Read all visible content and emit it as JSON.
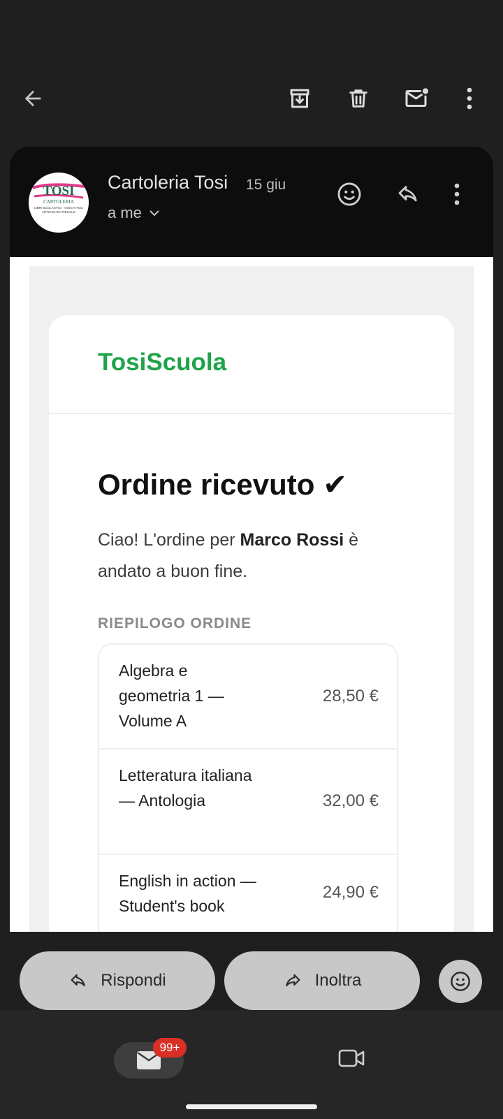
{
  "toolbar": {
    "back_icon": "arrow-back-icon",
    "archive_icon": "archive-icon",
    "delete_icon": "trash-icon",
    "mark_unread_icon": "mark-unread-icon",
    "more_icon": "more-vert-icon"
  },
  "message": {
    "sender_name": "Cartoleria Tosi",
    "date": "15 giu",
    "recipient": "a me",
    "avatar": {
      "line1": "TOSI",
      "line2": "CARTOLERIA",
      "line3": "LIBRI SCOLASTICI · GIOCATTOLI",
      "line4": "ARTICOLI DA REGALO"
    }
  },
  "email": {
    "brand": "TosiScuola",
    "headline": "Ordine ricevuto ✔",
    "intro_prefix": "Ciao! L'ordine per ",
    "customer_name": "Marco Rossi",
    "intro_suffix": " è andato a buon fine.",
    "summary_label": "RIEPILOGO ORDINE",
    "items": [
      {
        "title": "Algebra e geometria 1 — Volume A",
        "price": "28,50 €"
      },
      {
        "title": "Letteratura italiana — Antologia",
        "price": "32,00 €"
      },
      {
        "title": "English in action — Student's book",
        "price": "24,90 €"
      }
    ]
  },
  "actions": {
    "reply_label": "Rispondi",
    "forward_label": "Inoltra"
  },
  "nav": {
    "mail_badge": "99+"
  },
  "colors": {
    "brand_green": "#1fa34a",
    "badge_red": "#d93025",
    "background": "#1f1f1f"
  }
}
